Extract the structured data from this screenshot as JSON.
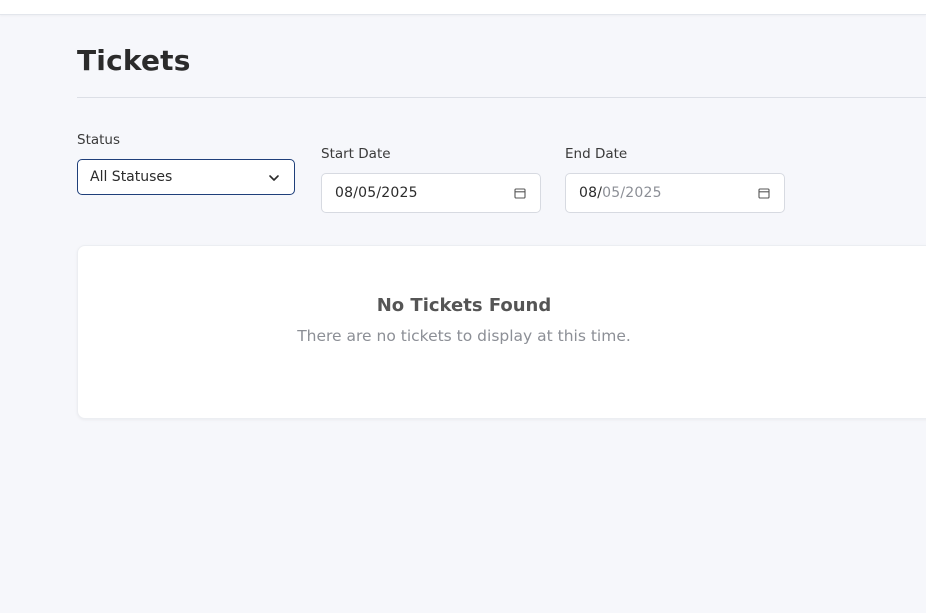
{
  "page": {
    "title": "Tickets"
  },
  "filters": {
    "status": {
      "label": "Status",
      "selected": "All Statuses"
    },
    "start_date": {
      "label": "Start Date",
      "month": "08",
      "day": "05",
      "year": "2025"
    },
    "end_date": {
      "label": "End Date",
      "month": "08",
      "day": "05",
      "year": "2025"
    }
  },
  "empty_state": {
    "title": "No Tickets Found",
    "message": "There are no tickets to display at this time."
  },
  "colors": {
    "background": "#f6f7fb",
    "select_border": "#1f3f7a",
    "card": "#ffffff"
  }
}
